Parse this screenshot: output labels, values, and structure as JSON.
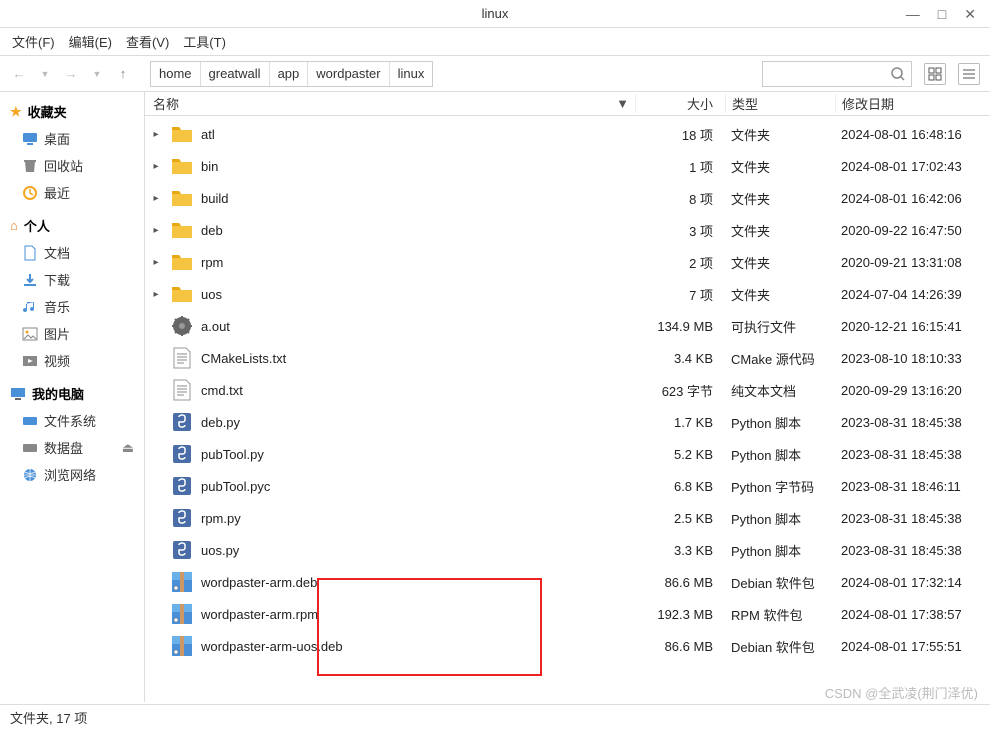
{
  "window": {
    "title": "linux"
  },
  "menubar": [
    {
      "label": "文件(F)"
    },
    {
      "label": "编辑(E)"
    },
    {
      "label": "查看(V)"
    },
    {
      "label": "工具(T)"
    }
  ],
  "breadcrumb": [
    "home",
    "greatwall",
    "app",
    "wordpaster",
    "linux"
  ],
  "sidebar": {
    "sec_fav": "收藏夹",
    "fav": [
      {
        "icon": "desktop",
        "label": "桌面"
      },
      {
        "icon": "trash",
        "label": "回收站"
      },
      {
        "icon": "recent",
        "label": "最近"
      }
    ],
    "sec_personal": "个人",
    "personal": [
      {
        "icon": "docs",
        "label": "文档"
      },
      {
        "icon": "download",
        "label": "下载"
      },
      {
        "icon": "music",
        "label": "音乐"
      },
      {
        "icon": "pictures",
        "label": "图片"
      },
      {
        "icon": "videos",
        "label": "视频"
      }
    ],
    "sec_computer": "我的电脑",
    "computer": [
      {
        "icon": "fsys",
        "label": "文件系统"
      },
      {
        "icon": "disk",
        "label": "数据盘"
      },
      {
        "icon": "net",
        "label": "浏览网络"
      }
    ]
  },
  "columns": {
    "name": "名称",
    "size": "大小",
    "type": "类型",
    "date": "修改日期"
  },
  "files": [
    {
      "expand": true,
      "icon": "folder",
      "name": "atl",
      "size": "18 项",
      "type": "文件夹",
      "date": "2024-08-01 16:48:16"
    },
    {
      "expand": true,
      "icon": "folder",
      "name": "bin",
      "size": "1 项",
      "type": "文件夹",
      "date": "2024-08-01 17:02:43"
    },
    {
      "expand": true,
      "icon": "folder",
      "name": "build",
      "size": "8 项",
      "type": "文件夹",
      "date": "2024-08-01 16:42:06"
    },
    {
      "expand": true,
      "icon": "folder",
      "name": "deb",
      "size": "3 项",
      "type": "文件夹",
      "date": "2020-09-22 16:47:50"
    },
    {
      "expand": true,
      "icon": "folder",
      "name": "rpm",
      "size": "2 项",
      "type": "文件夹",
      "date": "2020-09-21 13:31:08"
    },
    {
      "expand": true,
      "icon": "folder",
      "name": "uos",
      "size": "7 项",
      "type": "文件夹",
      "date": "2024-07-04 14:26:39"
    },
    {
      "expand": false,
      "icon": "exec",
      "name": "a.out",
      "size": "134.9 MB",
      "type": "可执行文件",
      "date": "2020-12-21 16:15:41"
    },
    {
      "expand": false,
      "icon": "text",
      "name": "CMakeLists.txt",
      "size": "3.4 KB",
      "type": "CMake 源代码",
      "date": "2023-08-10 18:10:33"
    },
    {
      "expand": false,
      "icon": "text",
      "name": "cmd.txt",
      "size": "623 字节",
      "type": "纯文本文档",
      "date": "2020-09-29 13:16:20"
    },
    {
      "expand": false,
      "icon": "python",
      "name": "deb.py",
      "size": "1.7 KB",
      "type": "Python 脚本",
      "date": "2023-08-31 18:45:38"
    },
    {
      "expand": false,
      "icon": "python",
      "name": "pubTool.py",
      "size": "5.2 KB",
      "type": "Python 脚本",
      "date": "2023-08-31 18:45:38"
    },
    {
      "expand": false,
      "icon": "python",
      "name": "pubTool.pyc",
      "size": "6.8 KB",
      "type": "Python 字节码",
      "date": "2023-08-31 18:46:11"
    },
    {
      "expand": false,
      "icon": "python",
      "name": "rpm.py",
      "size": "2.5 KB",
      "type": "Python 脚本",
      "date": "2023-08-31 18:45:38"
    },
    {
      "expand": false,
      "icon": "python",
      "name": "uos.py",
      "size": "3.3 KB",
      "type": "Python 脚本",
      "date": "2023-08-31 18:45:38"
    },
    {
      "expand": false,
      "icon": "pkg",
      "name": "wordpaster-arm.deb",
      "size": "86.6 MB",
      "type": "Debian 软件包",
      "date": "2024-08-01 17:32:14"
    },
    {
      "expand": false,
      "icon": "pkg",
      "name": "wordpaster-arm.rpm",
      "size": "192.3 MB",
      "type": "RPM 软件包",
      "date": "2024-08-01 17:38:57"
    },
    {
      "expand": false,
      "icon": "pkg",
      "name": "wordpaster-arm-uos.deb",
      "size": "86.6 MB",
      "type": "Debian 软件包",
      "date": "2024-08-01 17:55:51"
    }
  ],
  "statusbar": "文件夹, 17 项",
  "watermark": "CSDN @全武凌(荆门泽优)"
}
